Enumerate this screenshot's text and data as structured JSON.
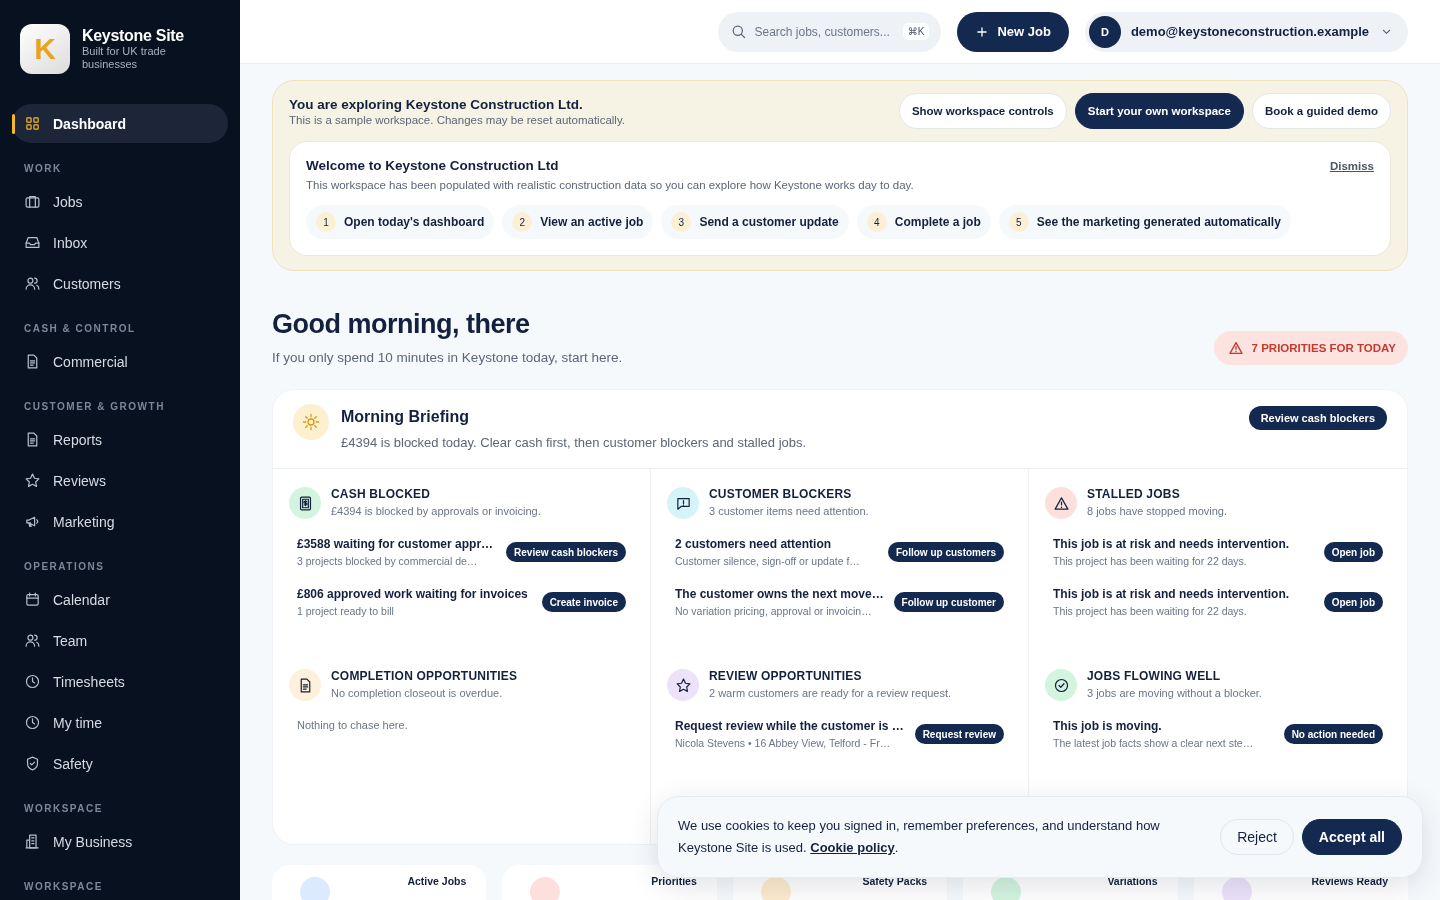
{
  "brand": {
    "logo_letter": "K",
    "name": "Keystone Site",
    "tagline": "Built for UK trade businesses"
  },
  "sidebar": [
    {
      "items": [
        {
          "label": "Dashboard",
          "selected": true
        }
      ]
    },
    {
      "section": "WORK",
      "items": [
        {
          "label": "Jobs",
          "selected": false
        },
        {
          "label": "Inbox",
          "selected": false
        },
        {
          "label": "Customers",
          "selected": false
        }
      ]
    },
    {
      "section": "CASH & CONTROL",
      "items": [
        {
          "label": "Commercial",
          "selected": false
        }
      ]
    },
    {
      "section": "CUSTOMER & GROWTH",
      "items": [
        {
          "label": "Reports",
          "selected": false
        },
        {
          "label": "Reviews",
          "selected": false
        },
        {
          "label": "Marketing",
          "selected": false
        }
      ]
    },
    {
      "section": "OPERATIONS",
      "items": [
        {
          "label": "Calendar",
          "selected": false
        },
        {
          "label": "Team",
          "selected": false
        },
        {
          "label": "Timesheets",
          "selected": false
        },
        {
          "label": "My time",
          "selected": false
        },
        {
          "label": "Safety",
          "selected": false
        }
      ]
    },
    {
      "section": "WORKSPACE",
      "items": [
        {
          "label": "My Business",
          "selected": false
        }
      ]
    },
    {
      "section": "WORKSPACE"
    }
  ],
  "header": {
    "search": {
      "placeholder": "Search jobs, customers...",
      "shortcut": "⌘K"
    },
    "new_job": "New Job",
    "user": {
      "initial": "D",
      "email": "demo@keystoneconstruction.example"
    }
  },
  "demo_banner": {
    "title": "You are exploring Keystone Construction Ltd.",
    "text": "This is a sample workspace. Changes may be reset automatically.",
    "buttons": [
      {
        "label": "Show workspace controls",
        "kind": "outline"
      },
      {
        "label": "Start your own workspace",
        "kind": "primary"
      },
      {
        "label": "Book a guided demo",
        "kind": "outline"
      }
    ],
    "welcome": {
      "title": "Welcome to Keystone Construction Ltd",
      "text": "This workspace has been populated with realistic construction data so you can explore how Keystone works day to day.",
      "dismiss": "Dismiss",
      "steps": [
        {
          "number": "1",
          "label": "Open today's dashboard"
        },
        {
          "number": "2",
          "label": "View an active job"
        },
        {
          "number": "3",
          "label": "Send a customer update"
        },
        {
          "number": "4",
          "label": "Complete a job"
        },
        {
          "number": "5",
          "label": "See the marketing generated automatically"
        }
      ]
    }
  },
  "greeting": {
    "title": "Good morning, there",
    "text": "If you only spend 10 minutes in Keystone today, start here.",
    "priorities": "7 PRIORITIES FOR TODAY"
  },
  "briefing": {
    "title": "Morning Briefing",
    "text": "£4394 is blocked today. Clear cash first, then customer blockers and stalled jobs.",
    "button": "Review cash blockers",
    "sections": [
      {
        "title": "CASH BLOCKED",
        "subtitle": "£4394 is blocked by approvals or invoicing.",
        "color": "#d3f5df",
        "items": [
          {
            "title": "£3588 waiting for customer appr…",
            "detail": "3 projects blocked by commercial de…",
            "action": "Review cash blockers"
          },
          {
            "title": "£806 approved work waiting for invoices",
            "detail": "1 project ready to bill",
            "action": "Create invoice"
          }
        ]
      },
      {
        "title": "CUSTOMER BLOCKERS",
        "subtitle": "3 customer items need attention.",
        "color": "#d4f4f8",
        "items": [
          {
            "title": "2 customers need attention",
            "detail": "Customer silence, sign-off or update f…",
            "action": "Follow up customers"
          },
          {
            "title": "The customer owns the next move…",
            "detail": "No variation pricing, approval or invoicin…",
            "action": "Follow up customer"
          }
        ]
      },
      {
        "title": "STALLED JOBS",
        "subtitle": "8 jobs have stopped moving.",
        "color": "#fde0dc",
        "items": [
          {
            "title": "This job is at risk and needs intervention.",
            "detail": "This project has been waiting for 22 days.",
            "action": "Open job"
          },
          {
            "title": "This job is at risk and needs intervention.",
            "detail": "This project has been waiting for 22 days.",
            "action": "Open job"
          }
        ]
      },
      {
        "title": "COMPLETION OPPORTUNITIES",
        "subtitle": "No completion closeout is overdue.",
        "color": "#fdf1dc",
        "empty": "Nothing to chase here."
      },
      {
        "title": "REVIEW OPPORTUNITIES",
        "subtitle": "2 warm customers are ready for a review request.",
        "color": "#ece3fb",
        "items": [
          {
            "title": "Request review while the customer is …",
            "detail": "Nicola Stevens • 16 Abbey View, Telford - Fr…",
            "action": "Request review"
          }
        ]
      },
      {
        "title": "JOBS FLOWING WELL",
        "subtitle": "3 jobs are moving without a blocker.",
        "color": "#d3f5df",
        "items": [
          {
            "title": "This job is moving.",
            "detail": "The latest job facts show a clear next ste…",
            "action": "No action needed"
          }
        ]
      }
    ]
  },
  "stats": [
    {
      "label": "Active Jobs",
      "color": "#dbeafe"
    },
    {
      "label": "Priorities",
      "color": "#fde0dc"
    },
    {
      "label": "Safety Packs",
      "color": "#fdeccf"
    },
    {
      "label": "Variations",
      "color": "#d3f5df"
    },
    {
      "label": "Reviews Ready",
      "color": "#ece3fb"
    }
  ],
  "cookie": {
    "text": "We use cookies to keep you signed in, remember preferences, and understand how Keystone Site is used.",
    "link": "Cookie policy",
    "after": ".",
    "reject": "Reject",
    "accept": "Accept all"
  }
}
